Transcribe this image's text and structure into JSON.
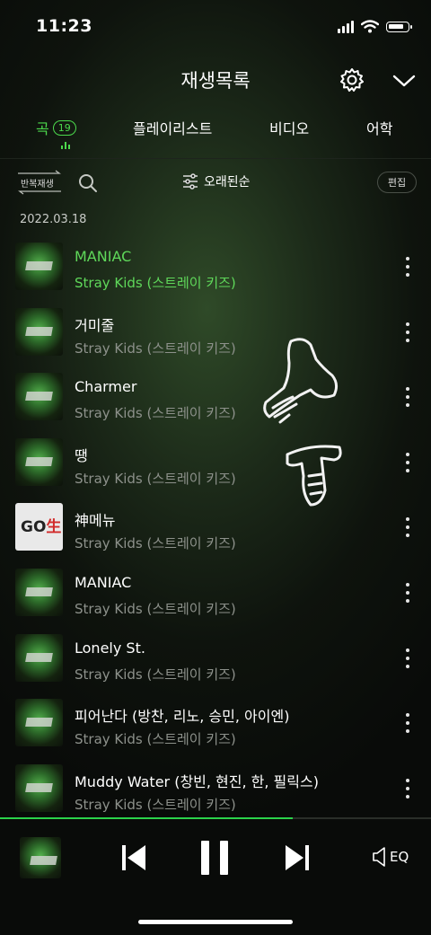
{
  "status_bar": {
    "time": "11:23",
    "icons": [
      "signal-icon",
      "wifi-icon",
      "battery-icon"
    ]
  },
  "header": {
    "title": "재생목록",
    "settings_icon": "gear-icon",
    "collapse_icon": "chevron-down-icon"
  },
  "tabs": [
    {
      "label": "곡",
      "count": "19",
      "active": true
    },
    {
      "label": "플레이리스트"
    },
    {
      "label": "비디오"
    },
    {
      "label": "어학"
    }
  ],
  "toolbar": {
    "repeat_label": "반복재생",
    "sort_label": "오래된순",
    "edit_label": "편집"
  },
  "date": "2022.03.18",
  "songs": [
    {
      "title": "MANIAC",
      "artist": "Stray Kids (스트레이 키즈)",
      "active": true,
      "art": "sk"
    },
    {
      "title": "거미줄",
      "artist": "Stray Kids (스트레이 키즈)",
      "art": "sk"
    },
    {
      "title": "Charmer",
      "artist": "Stray Kids (스트레이 키즈)",
      "art": "sk"
    },
    {
      "title": "땡",
      "artist": "Stray Kids (스트레이 키즈)",
      "art": "sk"
    },
    {
      "title": "神메뉴",
      "artist": "Stray Kids (스트레이 키즈)",
      "art": "go"
    },
    {
      "title": "MANIAC",
      "artist": "Stray Kids (스트레이 키즈)",
      "art": "sk"
    },
    {
      "title": "Lonely St.",
      "artist": "Stray Kids (스트레이 키즈)",
      "art": "sk"
    },
    {
      "title": "피어난다 (방찬, 리노, 승민, 아이엔)",
      "artist": "Stray Kids (스트레이 키즈)",
      "art": "sk"
    },
    {
      "title": "Muddy Water (창빈, 현진, 한, 필릭스)",
      "artist": "Stray Kids (스트레이 키즈)",
      "art": "sk"
    }
  ],
  "go_art": {
    "logo_a": "GO",
    "logo_b": "生"
  },
  "player": {
    "progress": 0.68,
    "eq_label": "EQ"
  },
  "colors": {
    "accent": "#4cd94c",
    "progress": "#2bd24a"
  }
}
